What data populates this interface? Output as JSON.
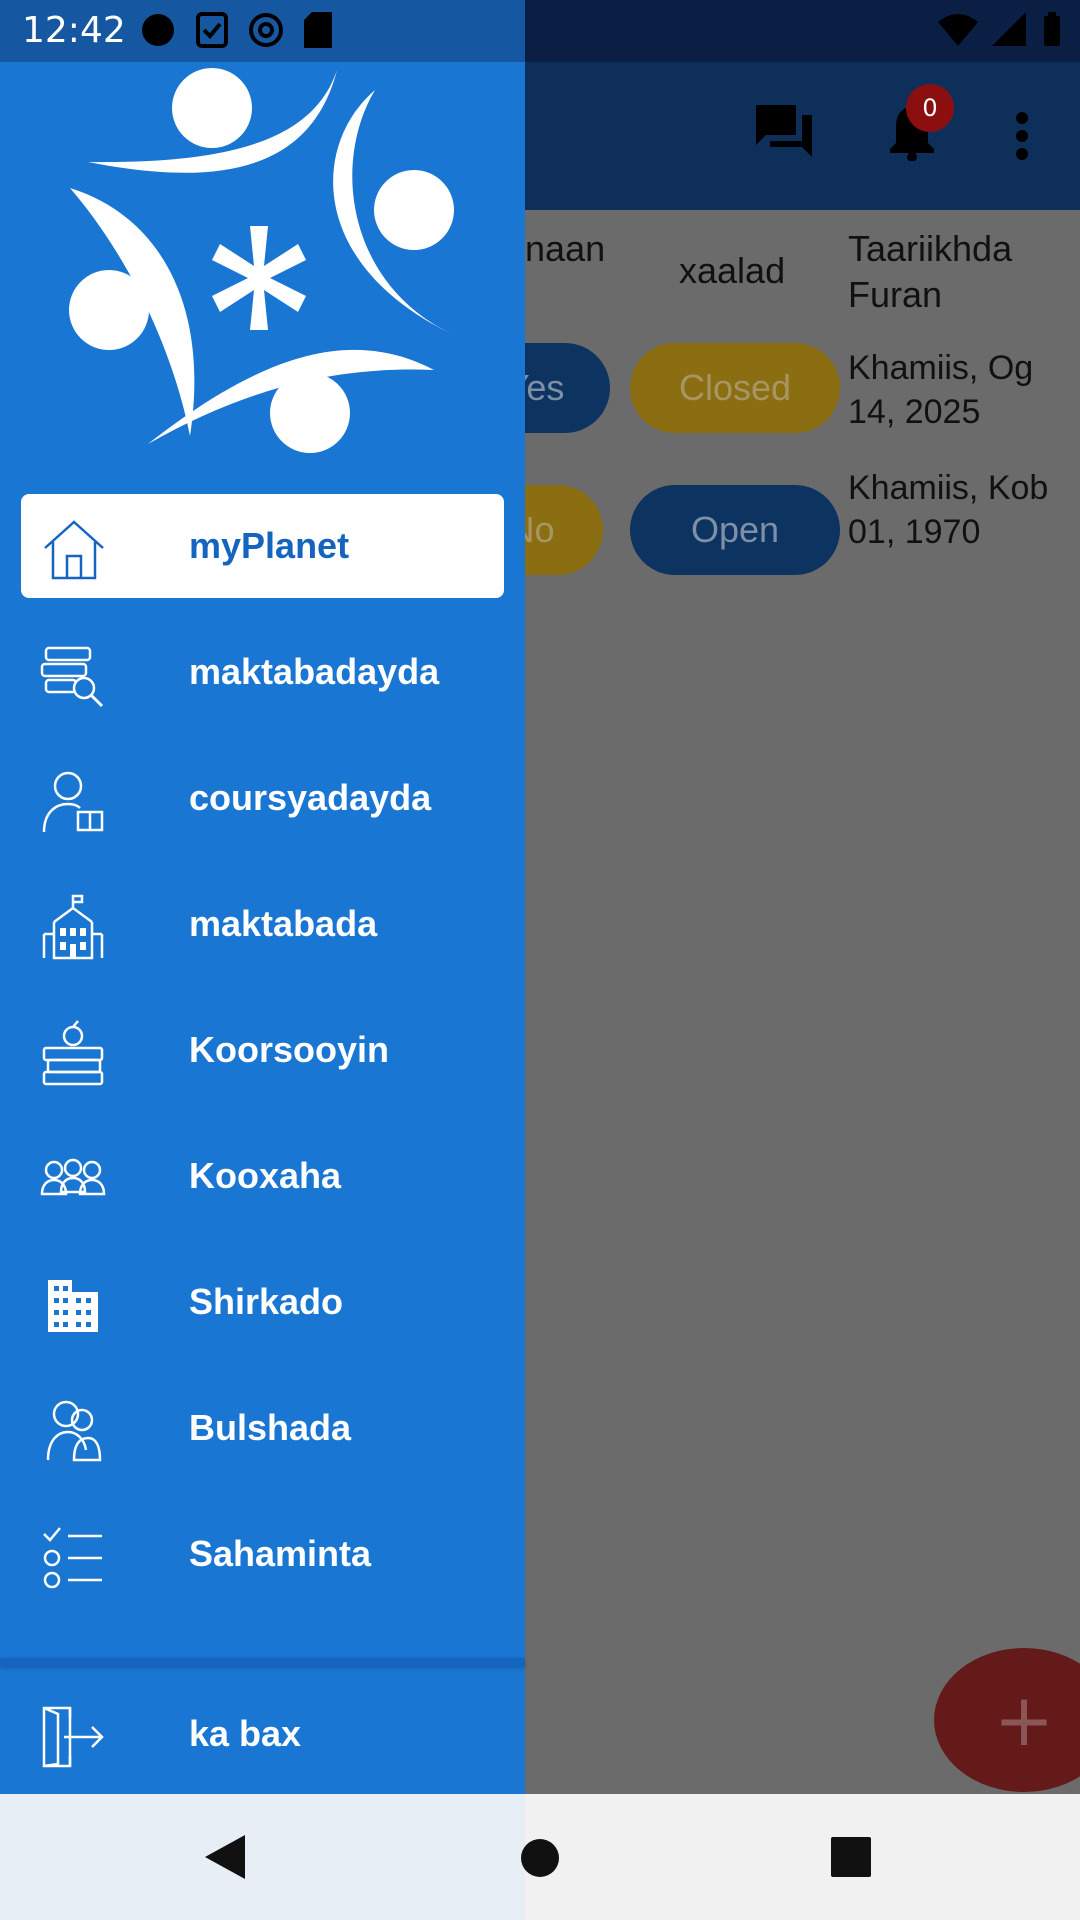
{
  "status_bar": {
    "time": "12:42"
  },
  "app_bar": {
    "notification_count": "0"
  },
  "table": {
    "headers": [
      "dnaan",
      "xaalad",
      "Taariikhda Furan"
    ],
    "rows": [
      {
        "answer": "Yes",
        "status": "Closed",
        "date": "Khamiis, Og 14, 2025"
      },
      {
        "answer": "No",
        "status": "Open",
        "date": "Khamiis, Kob 01, 1970"
      }
    ]
  },
  "fab": {
    "label": "+"
  },
  "drawer": {
    "items": [
      {
        "label": "myPlanet",
        "icon": "home-icon",
        "active": true
      },
      {
        "label": "maktabadayda",
        "icon": "my-library-icon"
      },
      {
        "label": "coursyadayda",
        "icon": "my-courses-icon"
      },
      {
        "label": "maktabada",
        "icon": "library-building-icon"
      },
      {
        "label": "Koorsooyin",
        "icon": "courses-books-icon"
      },
      {
        "label": "Kooxaha",
        "icon": "teams-icon"
      },
      {
        "label": "Shirkado",
        "icon": "enterprises-icon"
      },
      {
        "label": "Bulshada",
        "icon": "community-icon"
      },
      {
        "label": "Sahaminta",
        "icon": "survey-icon"
      }
    ],
    "logout": {
      "label": "ka bax",
      "icon": "logout-icon"
    }
  },
  "colors": {
    "drawer_bg": "#1976d2",
    "active_text": "#1565c0",
    "open_pill": "#0d3360",
    "closed_pill": "#8c6e12",
    "fab": "#651a1a"
  }
}
